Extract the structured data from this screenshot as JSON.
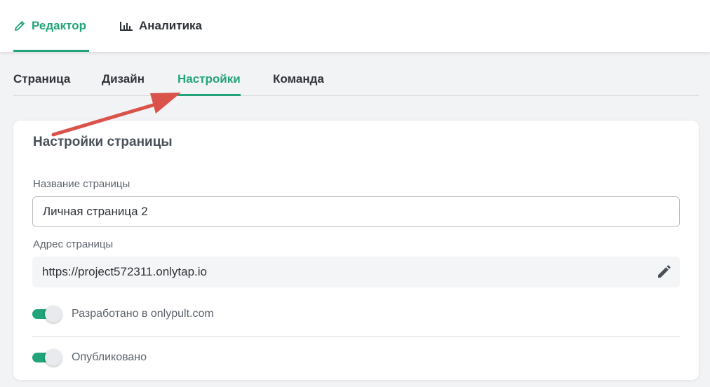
{
  "header": {
    "tabs": [
      {
        "label": "Редактор",
        "icon": "pencil-icon",
        "active": true
      },
      {
        "label": "Аналитика",
        "icon": "bar-chart-icon",
        "active": false
      }
    ]
  },
  "subtabs": [
    {
      "label": "Страница",
      "active": false
    },
    {
      "label": "Дизайн",
      "active": false
    },
    {
      "label": "Настройки",
      "active": true
    },
    {
      "label": "Команда",
      "active": false
    }
  ],
  "settings": {
    "title": "Настройки страницы",
    "name_label": "Название страницы",
    "name_value": "Личная страница 2",
    "address_label": "Адрес страницы",
    "address_value": "https://project572311.onlytap.io",
    "toggles": [
      {
        "label": "Разработано в onlypult.com",
        "on": true
      },
      {
        "label": "Опубликовано",
        "on": true
      }
    ]
  },
  "colors": {
    "accent": "#22a37a",
    "annotation_arrow": "#d9534a",
    "background": "#f2f3f5"
  }
}
